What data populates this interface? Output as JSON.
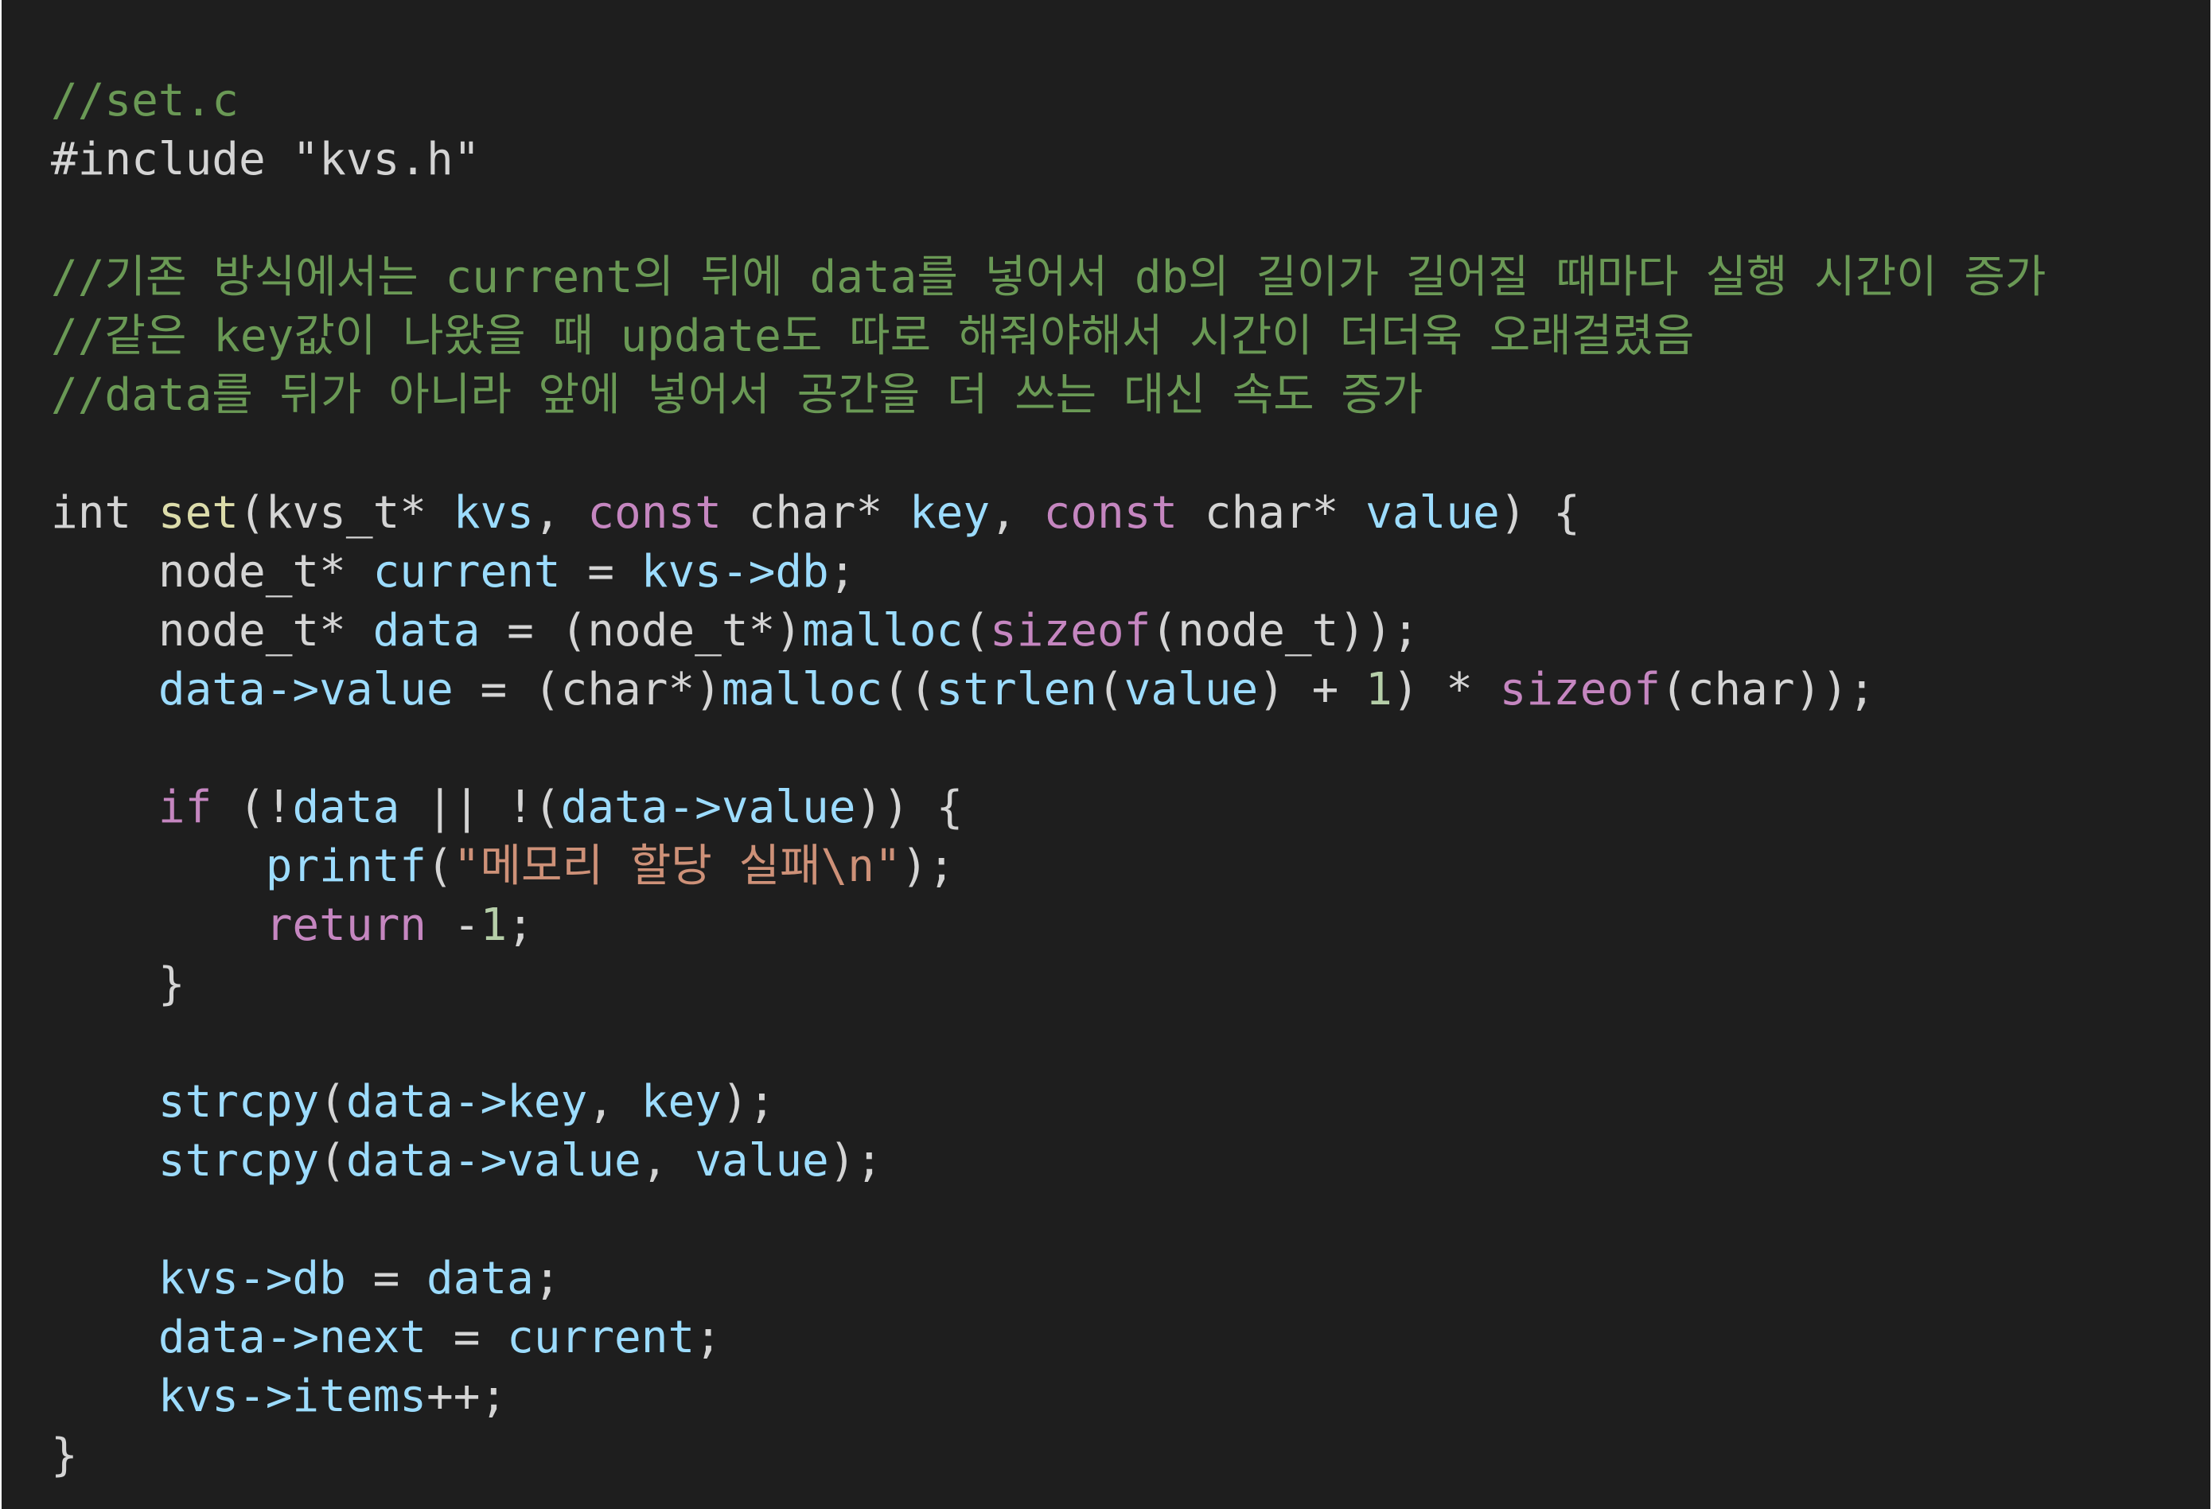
{
  "editor": {
    "language": "c",
    "theme": {
      "background": "#1e1e1e",
      "colors": {
        "plain": "#d4d4d4",
        "comment": "#6a9955",
        "keyword": "#c586c0",
        "function": "#dcdcaa",
        "variable": "#9cdcfe",
        "string": "#ce9178",
        "number": "#b5cea8"
      }
    },
    "lines": [
      [
        {
          "t": "//set.c",
          "c": "comment"
        }
      ],
      [
        {
          "t": "#include \"kvs.h\"",
          "c": "plain"
        }
      ],
      [],
      [
        {
          "t": "//기존 방식에서는 current의 뒤에 data를 넣어서 db의 길이가 길어질 때마다 실행 시간이 증가",
          "c": "comment"
        }
      ],
      [
        {
          "t": "//같은 key값이 나왔을 때 update도 따로 해줘야해서 시간이 더더욱 오래걸렸음",
          "c": "comment"
        }
      ],
      [
        {
          "t": "//data를 뒤가 아니라 앞에 넣어서 공간을 더 쓰는 대신 속도 증가",
          "c": "comment"
        }
      ],
      [],
      [
        {
          "t": "int ",
          "c": "plain"
        },
        {
          "t": "set",
          "c": "function"
        },
        {
          "t": "(kvs_t* ",
          "c": "plain"
        },
        {
          "t": "kvs",
          "c": "variable"
        },
        {
          "t": ", ",
          "c": "plain"
        },
        {
          "t": "const",
          "c": "keyword"
        },
        {
          "t": " char* ",
          "c": "plain"
        },
        {
          "t": "key",
          "c": "variable"
        },
        {
          "t": ", ",
          "c": "plain"
        },
        {
          "t": "const",
          "c": "keyword"
        },
        {
          "t": " char* ",
          "c": "plain"
        },
        {
          "t": "value",
          "c": "variable"
        },
        {
          "t": ") {",
          "c": "plain"
        }
      ],
      [
        {
          "t": "    node_t* ",
          "c": "plain"
        },
        {
          "t": "current",
          "c": "variable"
        },
        {
          "t": " = ",
          "c": "plain"
        },
        {
          "t": "kvs->db",
          "c": "variable"
        },
        {
          "t": ";",
          "c": "plain"
        }
      ],
      [
        {
          "t": "    node_t* ",
          "c": "plain"
        },
        {
          "t": "data",
          "c": "variable"
        },
        {
          "t": " = (node_t*)",
          "c": "plain"
        },
        {
          "t": "malloc",
          "c": "variable"
        },
        {
          "t": "(",
          "c": "plain"
        },
        {
          "t": "sizeof",
          "c": "keyword"
        },
        {
          "t": "(node_t));",
          "c": "plain"
        }
      ],
      [
        {
          "t": "    ",
          "c": "plain"
        },
        {
          "t": "data->value",
          "c": "variable"
        },
        {
          "t": " = (char*)",
          "c": "plain"
        },
        {
          "t": "malloc",
          "c": "variable"
        },
        {
          "t": "((",
          "c": "plain"
        },
        {
          "t": "strlen",
          "c": "variable"
        },
        {
          "t": "(",
          "c": "plain"
        },
        {
          "t": "value",
          "c": "variable"
        },
        {
          "t": ") + ",
          "c": "plain"
        },
        {
          "t": "1",
          "c": "number"
        },
        {
          "t": ") * ",
          "c": "plain"
        },
        {
          "t": "sizeof",
          "c": "keyword"
        },
        {
          "t": "(char));",
          "c": "plain"
        }
      ],
      [],
      [
        {
          "t": "    ",
          "c": "plain"
        },
        {
          "t": "if",
          "c": "keyword"
        },
        {
          "t": " (!",
          "c": "plain"
        },
        {
          "t": "data",
          "c": "variable"
        },
        {
          "t": " || !(",
          "c": "plain"
        },
        {
          "t": "data->value",
          "c": "variable"
        },
        {
          "t": ")) {",
          "c": "plain"
        }
      ],
      [
        {
          "t": "        ",
          "c": "plain"
        },
        {
          "t": "printf",
          "c": "variable"
        },
        {
          "t": "(",
          "c": "plain"
        },
        {
          "t": "\"메모리 할당 실패\\n\"",
          "c": "string"
        },
        {
          "t": ");",
          "c": "plain"
        }
      ],
      [
        {
          "t": "        ",
          "c": "plain"
        },
        {
          "t": "return",
          "c": "keyword"
        },
        {
          "t": " -",
          "c": "plain"
        },
        {
          "t": "1",
          "c": "number"
        },
        {
          "t": ";",
          "c": "plain"
        }
      ],
      [
        {
          "t": "    }",
          "c": "plain"
        }
      ],
      [],
      [
        {
          "t": "    ",
          "c": "plain"
        },
        {
          "t": "strcpy",
          "c": "variable"
        },
        {
          "t": "(",
          "c": "plain"
        },
        {
          "t": "data->key",
          "c": "variable"
        },
        {
          "t": ", ",
          "c": "plain"
        },
        {
          "t": "key",
          "c": "variable"
        },
        {
          "t": ");",
          "c": "plain"
        }
      ],
      [
        {
          "t": "    ",
          "c": "plain"
        },
        {
          "t": "strcpy",
          "c": "variable"
        },
        {
          "t": "(",
          "c": "plain"
        },
        {
          "t": "data->value",
          "c": "variable"
        },
        {
          "t": ", ",
          "c": "plain"
        },
        {
          "t": "value",
          "c": "variable"
        },
        {
          "t": ");",
          "c": "plain"
        }
      ],
      [],
      [
        {
          "t": "    ",
          "c": "plain"
        },
        {
          "t": "kvs->db",
          "c": "variable"
        },
        {
          "t": " = ",
          "c": "plain"
        },
        {
          "t": "data",
          "c": "variable"
        },
        {
          "t": ";",
          "c": "plain"
        }
      ],
      [
        {
          "t": "    ",
          "c": "plain"
        },
        {
          "t": "data->next",
          "c": "variable"
        },
        {
          "t": " = ",
          "c": "plain"
        },
        {
          "t": "current",
          "c": "variable"
        },
        {
          "t": ";",
          "c": "plain"
        }
      ],
      [
        {
          "t": "    ",
          "c": "plain"
        },
        {
          "t": "kvs->items",
          "c": "variable"
        },
        {
          "t": "++;",
          "c": "plain"
        }
      ],
      [
        {
          "t": "}",
          "c": "plain"
        }
      ]
    ]
  }
}
